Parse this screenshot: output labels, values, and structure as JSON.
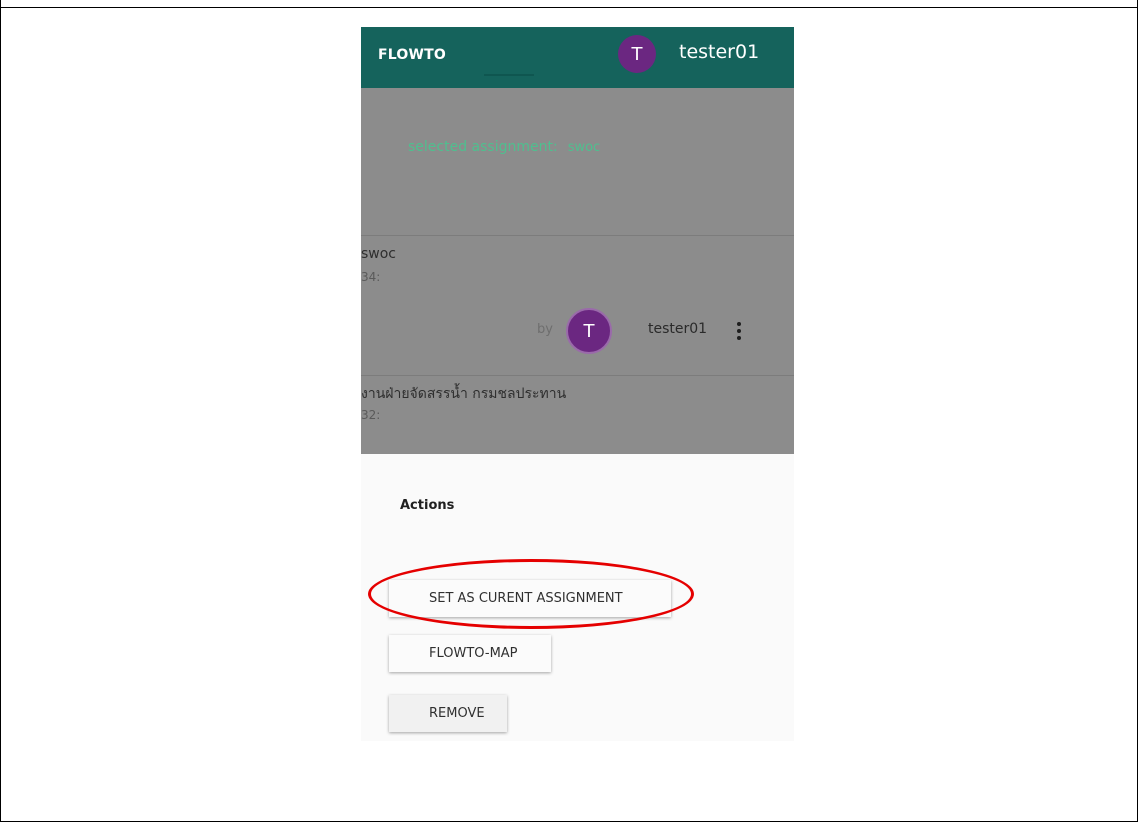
{
  "appbar": {
    "title": "FLOWTO",
    "avatar_letter": "T",
    "username": "tester01"
  },
  "selected": {
    "label": "selected assignment:",
    "value": "swoc"
  },
  "items": [
    {
      "title": "swoc",
      "subtitle": "34:",
      "by": "by",
      "avatar_letter": "T",
      "user": "tester01"
    },
    {
      "title": "งานฝ่ายจัดสรรน้ำ กรมชลประทาน",
      "subtitle": "32:"
    }
  ],
  "sheet": {
    "title": "Actions",
    "buttons": [
      "SET AS CURENT ASSIGNMENT",
      "FLOWTO-MAP",
      "REMOVE"
    ]
  },
  "colors": {
    "appbar": "#15635c",
    "avatar": "#6b2781",
    "accent_text": "#4fbf8f",
    "highlight": "#e50000"
  }
}
